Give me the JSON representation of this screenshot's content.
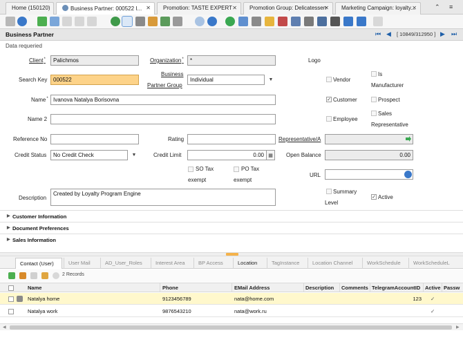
{
  "tabs": [
    {
      "label": "Home (150120)"
    },
    {
      "label": "Business Partner: 000522 I..."
    },
    {
      "label": "Promotion: TASTE EXPERT"
    },
    {
      "label": "Promotion Group: Delicatessen"
    },
    {
      "label": "Marketing Campaign: loyalty..."
    }
  ],
  "window": {
    "title": "Business Partner",
    "record": "[ 10849/312950 ]",
    "status": "Data requeried"
  },
  "form": {
    "client_label": "Client",
    "client_value": "Palichmos",
    "organization_label": "Organization",
    "organization_value": "*",
    "logo_label": "Logo",
    "search_key_label": "Search Key",
    "search_key_value": "000522",
    "bp_group_label_1": "Business",
    "bp_group_label_2": "Partner Group",
    "bp_group_value": "Individual",
    "name_label": "Name",
    "name_value": "Ivanova Natalya Borisovna",
    "name2_label": "Name 2",
    "name2_value": "",
    "reference_label": "Reference No",
    "reference_value": "",
    "rating_label": "Rating",
    "rating_value": "",
    "representative_label": "Representative/A",
    "representative_value": "",
    "credit_status_label": "Credit Status",
    "credit_status_value": "No Credit Check",
    "credit_limit_label": "Credit Limit",
    "credit_limit_value": "0.00",
    "open_balance_label": "Open Balance",
    "open_balance_value": "0.00",
    "so_tax_label_1": "SO Tax",
    "so_tax_label_2": "exempt",
    "po_tax_label_1": "PO Tax",
    "po_tax_label_2": "exempt",
    "url_label": "URL",
    "url_value": "",
    "description_label": "Description",
    "description_value": "Created by Loyalty Program Engine",
    "vendor_label": "Vendor",
    "is_manufacturer_label_1": "Is",
    "is_manufacturer_label_2": "Manufacturer",
    "customer_label": "Customer",
    "prospect_label": "Prospect",
    "employee_label": "Employee",
    "sales_rep_label_1": "Sales",
    "sales_rep_label_2": "Representative",
    "summary_level_label_1": "Summary",
    "summary_level_label_2": "Level",
    "active_label": "Active",
    "customer_checked": true,
    "active_checked": true
  },
  "sections": [
    {
      "label": "Customer Information"
    },
    {
      "label": "Document Preferences"
    },
    {
      "label": "Sales Information"
    }
  ],
  "child_tabs": [
    {
      "label": "Contact (User)"
    },
    {
      "label": "User Mail"
    },
    {
      "label": "AD_User_Roles"
    },
    {
      "label": "Interest Area"
    },
    {
      "label": "BP Access"
    },
    {
      "label": "Location"
    },
    {
      "label": "TagInstance"
    },
    {
      "label": "Location Channel"
    },
    {
      "label": "WorkSchedule"
    },
    {
      "label": "WorkScheduleL"
    }
  ],
  "grid": {
    "record_count": "2 Records",
    "columns": [
      "Name",
      "Phone",
      "EMail Address",
      "Description",
      "Comments",
      "TelegramAccountID",
      "Active",
      "Passw"
    ],
    "rows": [
      {
        "name": "Natalya home",
        "phone": "9123456789",
        "email": "nata@home.com",
        "description": "",
        "comments": "",
        "telegram": "123",
        "active": "✓"
      },
      {
        "name": "Natalya work",
        "phone": "9876543210",
        "email": "nata@work.ru",
        "description": "",
        "comments": "",
        "telegram": "",
        "active": "✓"
      }
    ]
  }
}
